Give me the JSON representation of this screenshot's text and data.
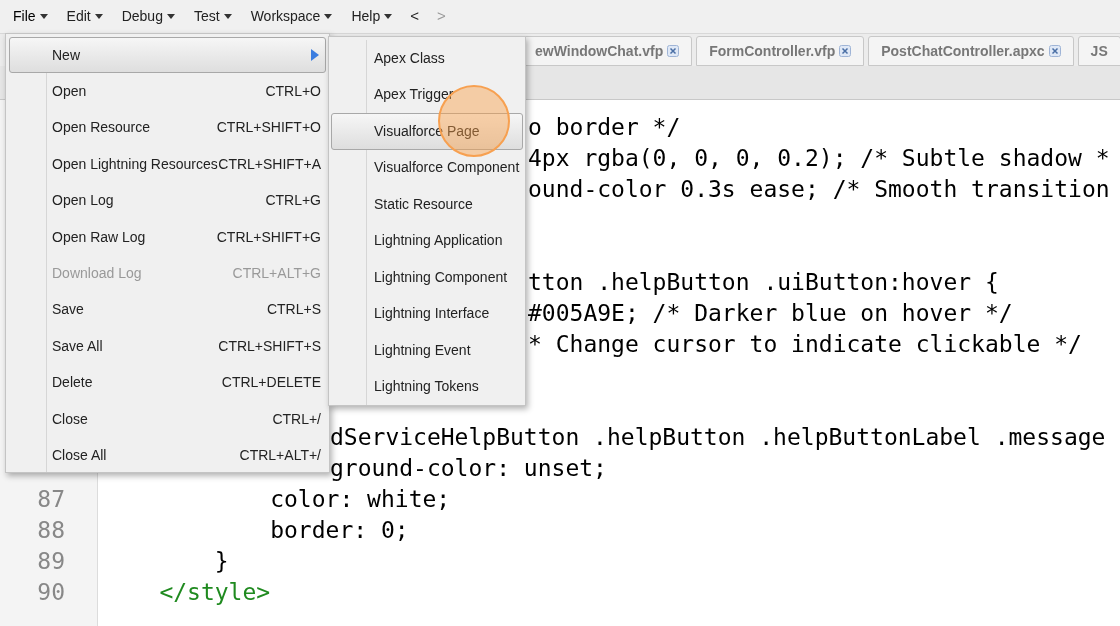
{
  "menubar": {
    "menus": [
      {
        "label": "File",
        "selected": true
      },
      {
        "label": "Edit",
        "selected": false
      },
      {
        "label": "Debug",
        "selected": false
      },
      {
        "label": "Test",
        "selected": false
      },
      {
        "label": "Workspace",
        "selected": false
      },
      {
        "label": "Help",
        "selected": false
      }
    ],
    "nav": [
      {
        "label": "<",
        "disabled": false
      },
      {
        "label": ">",
        "disabled": true
      }
    ]
  },
  "tabs": [
    {
      "label": "ewWindowChat.vfp"
    },
    {
      "label": "FormController.vfp"
    },
    {
      "label": "PostChatController.apxc"
    },
    {
      "label": "JS"
    }
  ],
  "editor": {
    "lines": [
      {
        "kind": "behind_submenu",
        "text": "o border */"
      },
      {
        "kind": "behind_submenu",
        "text": "4px rgba(0, 0, 0, 0.2); /* Subtle shadow *"
      },
      {
        "kind": "behind_submenu",
        "text": "ound-color 0.3s ease; /* Smooth transition"
      },
      {
        "kind": "blank"
      },
      {
        "kind": "blank"
      },
      {
        "kind": "behind_submenu",
        "text": "tton .helpButton .uiButton:hover {"
      },
      {
        "kind": "behind_submenu",
        "text": "#005A9E; /* Darker blue on hover */"
      },
      {
        "kind": "behind_submenu",
        "text": "* Change cursor to indicate clickable */"
      },
      {
        "kind": "blank"
      },
      {
        "kind": "blank"
      },
      {
        "kind": "behind_menu",
        "text": "dServiceHelpButton .helpButton .helpButtonLabel .message"
      },
      {
        "kind": "behind_menu",
        "text": "ground-color: unset;"
      },
      {
        "kind": "full",
        "number": "87",
        "text": "            color: white;"
      },
      {
        "kind": "full",
        "number": "88",
        "text": "            border: 0;"
      },
      {
        "kind": "full",
        "number": "89",
        "text": "        }"
      },
      {
        "kind": "tag",
        "number": "90",
        "text": "    </style>"
      }
    ]
  },
  "file_menu": {
    "items": [
      {
        "label": "New",
        "submenu": true,
        "selected": true,
        "disabled": false
      },
      {
        "label": "Open",
        "shortcut": "CTRL+O",
        "selected": false,
        "disabled": false
      },
      {
        "label": "Open Resource",
        "shortcut": "CTRL+SHIFT+O",
        "selected": false,
        "disabled": false
      },
      {
        "label": "Open Lightning Resources",
        "shortcut": "CTRL+SHIFT+A",
        "selected": false,
        "disabled": false
      },
      {
        "label": "Open Log",
        "shortcut": "CTRL+G",
        "selected": false,
        "disabled": false
      },
      {
        "label": "Open Raw Log",
        "shortcut": "CTRL+SHIFT+G",
        "selected": false,
        "disabled": false
      },
      {
        "label": "Download Log",
        "shortcut": "CTRL+ALT+G",
        "selected": false,
        "disabled": true
      },
      {
        "label": "Save",
        "shortcut": "CTRL+S",
        "selected": false,
        "disabled": false
      },
      {
        "label": "Save All",
        "shortcut": "CTRL+SHIFT+S",
        "selected": false,
        "disabled": false
      },
      {
        "label": "Delete",
        "shortcut": "CTRL+DELETE",
        "selected": false,
        "disabled": false
      },
      {
        "label": "Close",
        "shortcut": "CTRL+/",
        "selected": false,
        "disabled": false
      },
      {
        "label": "Close All",
        "shortcut": "CTRL+ALT+/",
        "selected": false,
        "disabled": false
      }
    ]
  },
  "new_submenu": {
    "items": [
      {
        "label": "Apex Class",
        "selected": false
      },
      {
        "label": "Apex Trigger",
        "selected": false
      },
      {
        "label": "Visualforce Page",
        "selected": true
      },
      {
        "label": "Visualforce Component",
        "selected": false
      },
      {
        "label": "Static Resource",
        "selected": false
      },
      {
        "label": "Lightning Application",
        "selected": false
      },
      {
        "label": "Lightning Component",
        "selected": false
      },
      {
        "label": "Lightning Interface",
        "selected": false
      },
      {
        "label": "Lightning Event",
        "selected": false
      },
      {
        "label": "Lightning Tokens",
        "selected": false
      }
    ]
  }
}
